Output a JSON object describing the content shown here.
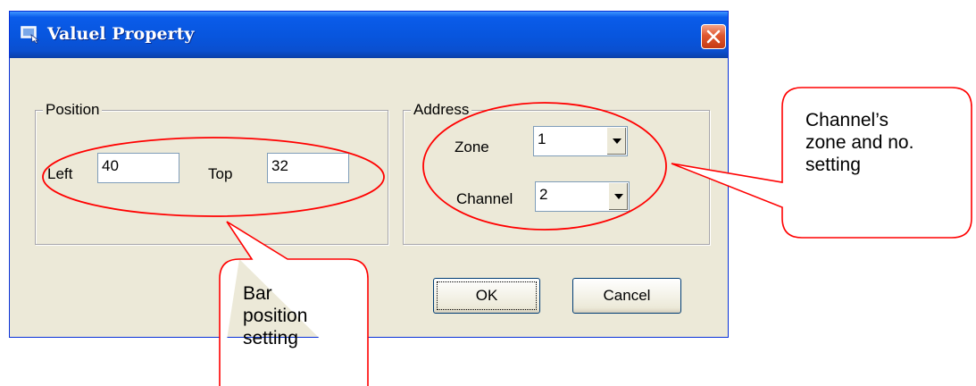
{
  "dialog": {
    "title": "Valuel Property"
  },
  "position_group": {
    "legend": "Position",
    "left_label": "Left",
    "left_value": "40",
    "top_label": "Top",
    "top_value": "32"
  },
  "address_group": {
    "legend": "Address",
    "zone_label": "Zone",
    "zone_value": "1",
    "channel_label": "Channel",
    "channel_value": "2"
  },
  "buttons": {
    "ok_label": "OK",
    "cancel_label": "Cancel"
  },
  "annotations": {
    "bar_position": [
      "Bar",
      "position",
      "setting"
    ],
    "channel_setting": [
      "Channel’s",
      "zone and no.",
      "setting"
    ],
    "highlight_color": "#ff0000"
  }
}
